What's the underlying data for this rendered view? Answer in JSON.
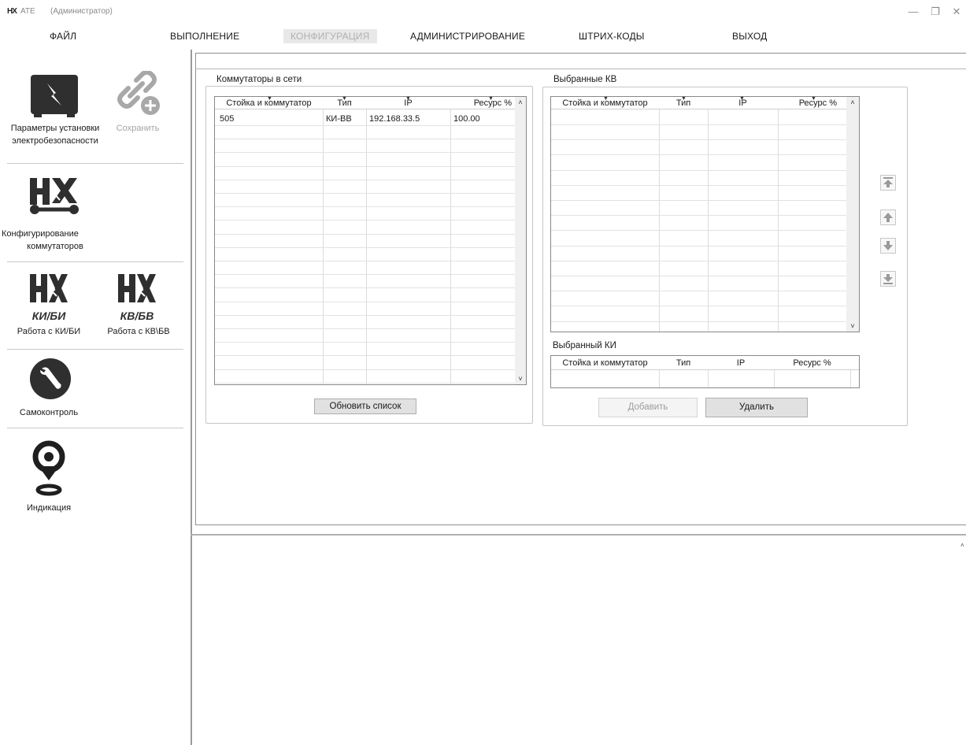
{
  "window": {
    "logo": "НХ",
    "title": "ATE",
    "subtitle": "(Администратор)",
    "minimize": "—",
    "maximize": "❐",
    "close": "✕"
  },
  "menu": {
    "file": "ФАЙЛ",
    "run": "ВЫПОЛНЕНИЕ",
    "config": "КОНФИГУРАЦИЯ",
    "admin": "АДМИНИСТРИРОВАНИЕ",
    "barcodes": "ШТРИХ-КОДЫ",
    "exit": "ВЫХОД"
  },
  "sidebar": {
    "safety_params_line1": "Параметры установки",
    "safety_params_line2": "электробезопасности",
    "save": "Сохранить",
    "switch_config_line1": "Конфигурирование",
    "switch_config_line2": "коммутаторов",
    "ki_bi_badge": "КИ/БИ",
    "kv_bv_badge": "КВ/БВ",
    "ki_bi_label": "Работа с КИ/БИ",
    "kv_bv_label": "Работа с КВ\\БВ",
    "selftest": "Самоконтроль",
    "indication": "Индикация"
  },
  "network_switches": {
    "title": "Коммутаторы в сети",
    "columns": [
      "Стойка и коммутатор",
      "Тип",
      "IP",
      "Ресурс %"
    ],
    "rows": [
      [
        "505",
        "КИ-ВВ",
        "192.168.33.5",
        "100.00"
      ]
    ],
    "refresh_button": "Обновить список"
  },
  "selected_kv": {
    "title": "Выбранные КВ",
    "columns": [
      "Стойка и коммутатор",
      "Тип",
      "IP",
      "Ресурс %"
    ]
  },
  "selected_ki": {
    "title": "Выбранный КИ",
    "columns": [
      "Стойка и коммутатор",
      "Тип",
      "IP",
      "Ресурс %"
    ]
  },
  "actions": {
    "add": "Добавить",
    "remove": "Удалить"
  },
  "scroll": {
    "up": "˄",
    "down": "˅"
  },
  "colors": {
    "icon_dark": "#2f2f2f",
    "icon_disabled": "#a8a8a8",
    "move_arrow": "#9a9a9a"
  }
}
